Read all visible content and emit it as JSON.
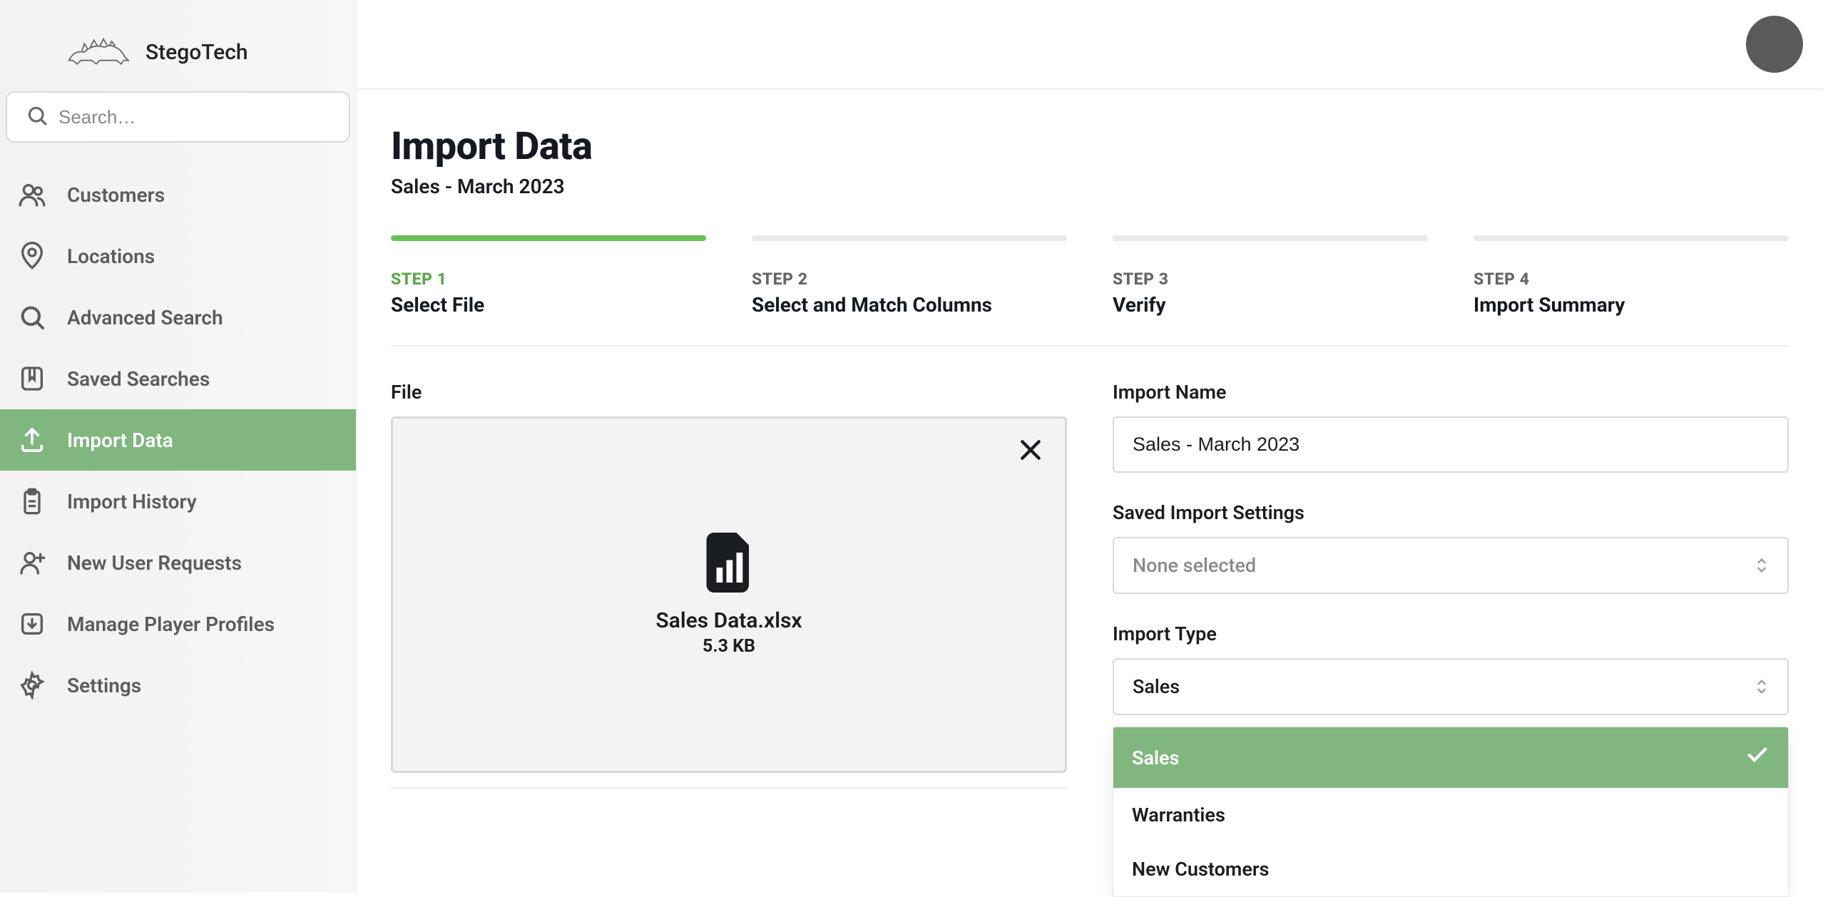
{
  "brand": {
    "name": "StegoTech"
  },
  "search": {
    "placeholder": "Search…"
  },
  "sidebar": {
    "items": [
      {
        "label": "Customers"
      },
      {
        "label": "Locations"
      },
      {
        "label": "Advanced Search"
      },
      {
        "label": "Saved Searches"
      },
      {
        "label": "Import Data"
      },
      {
        "label": "Import History"
      },
      {
        "label": "New User Requests"
      },
      {
        "label": "Manage Player Profiles"
      },
      {
        "label": "Settings"
      }
    ]
  },
  "page": {
    "title": "Import Data",
    "subtitle": "Sales - March 2023"
  },
  "steps": [
    {
      "label": "STEP 1",
      "title": "Select File"
    },
    {
      "label": "STEP 2",
      "title": "Select and Match Columns"
    },
    {
      "label": "STEP 3",
      "title": "Verify"
    },
    {
      "label": "STEP 4",
      "title": "Import Summary"
    }
  ],
  "file_section": {
    "label": "File",
    "name": "Sales Data.xlsx",
    "size": "5.3 KB"
  },
  "import_name": {
    "label": "Import Name",
    "value": "Sales - March 2023"
  },
  "saved_settings": {
    "label": "Saved Import Settings",
    "value": "None selected"
  },
  "import_type": {
    "label": "Import Type",
    "value": "Sales",
    "options": [
      "Sales",
      "Warranties",
      "New Customers"
    ]
  }
}
